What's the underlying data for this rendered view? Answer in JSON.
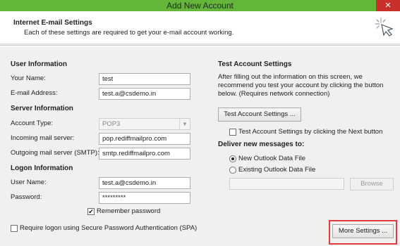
{
  "window": {
    "title": "Add New Account",
    "close_glyph": "✕"
  },
  "header": {
    "title": "Internet E-mail Settings",
    "subtitle": "Each of these settings are required to get your e-mail account working.",
    "icon": "sparkle-cursor-icon"
  },
  "user_info": {
    "heading": "User Information",
    "name_label": "Your Name:",
    "name_value": "test",
    "email_label": "E-mail Address:",
    "email_value": "test.a@csdemo.in"
  },
  "server_info": {
    "heading": "Server Information",
    "account_type_label": "Account Type:",
    "account_type_value": "POP3",
    "incoming_label": "Incoming mail server:",
    "incoming_value": "pop.rediffmailpro.com",
    "outgoing_label": "Outgoing mail server (SMTP):",
    "outgoing_value": "smtp.rediffmailpro.com"
  },
  "logon_info": {
    "heading": "Logon Information",
    "username_label": "User Name:",
    "username_value": "test.a@csdemo.in",
    "password_label": "Password:",
    "password_value": "*********",
    "remember_label": "Remember password",
    "remember_checked": true,
    "spa_label": "Require logon using Secure Password Authentication (SPA)",
    "spa_checked": false
  },
  "test_settings": {
    "heading": "Test Account Settings",
    "description_line1": "After filling out the information on this screen, we",
    "description_line2": "recommend you test your account by clicking the button",
    "description_line3": "below. (Requires network connection)",
    "test_button_label": "Test Account Settings ...",
    "next_check_label": "Test Account Settings by clicking the Next button",
    "next_check_checked": false
  },
  "deliver": {
    "heading": "Deliver new messages to:",
    "new_file_label": "New Outlook Data File",
    "existing_file_label": "Existing Outlook Data File",
    "selected": "new",
    "path_value": "",
    "browse_label": "Browse"
  },
  "more_settings_label": "More Settings ...",
  "colors": {
    "title_bar": "#63b63a",
    "close": "#c8302c",
    "highlight": "#e0393e"
  }
}
